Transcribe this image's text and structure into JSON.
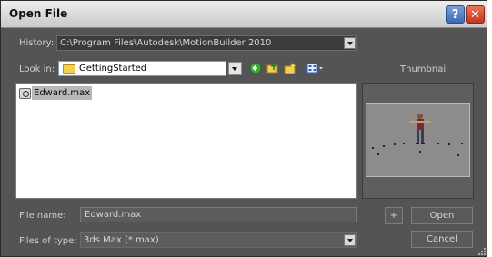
{
  "window": {
    "title": "Open File",
    "help_label": "?",
    "close_label": "✕"
  },
  "history": {
    "label": "History:",
    "value": "C:\\Program Files\\Autodesk\\MotionBuilder 2010"
  },
  "look_in": {
    "label": "Look in:",
    "value": "GettingStarted"
  },
  "toolbar": {
    "icons": [
      "back-icon",
      "up-folder-icon",
      "new-folder-icon",
      "view-menu-icon"
    ]
  },
  "files": [
    {
      "name": "Edward.max",
      "selected": true
    }
  ],
  "thumbnail": {
    "label": "Thumbnail"
  },
  "file_name": {
    "label": "File name:",
    "value": "Edward.max"
  },
  "file_type": {
    "label": "Files of type:",
    "value": "3ds Max (*.max)"
  },
  "buttons": {
    "plus_label": "+",
    "open_label": "Open",
    "cancel_label": "Cancel"
  },
  "colors": {
    "dialog_bg": "#545454",
    "title_bar": "#dcdcdc",
    "close_red": "#c2381e",
    "help_blue": "#3a6bb8"
  }
}
